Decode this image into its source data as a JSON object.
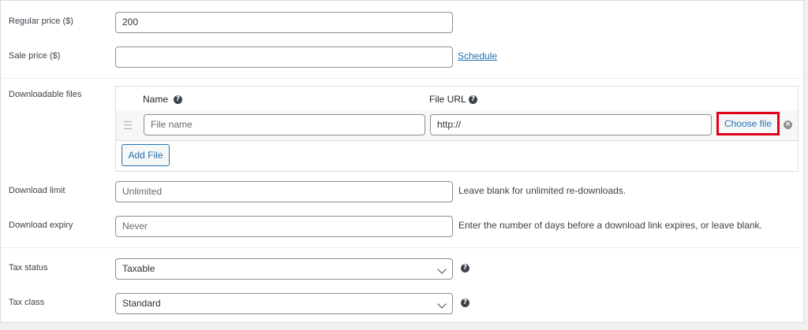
{
  "pricing": {
    "regular_label": "Regular price ($)",
    "regular_value": "200",
    "sale_label": "Sale price ($)",
    "sale_value": "",
    "schedule_link": "Schedule"
  },
  "downloads": {
    "label": "Downloadable files",
    "col_name": "Name",
    "col_url": "File URL",
    "file_name_placeholder": "File name",
    "file_url_value": "http://",
    "choose_file_label": "Choose file",
    "remove_icon": "×",
    "add_file_label": "Add File",
    "help_icon": "?"
  },
  "limits": {
    "limit_label": "Download limit",
    "limit_placeholder": "Unlimited",
    "limit_desc": "Leave blank for unlimited re-downloads.",
    "expiry_label": "Download expiry",
    "expiry_placeholder": "Never",
    "expiry_desc": "Enter the number of days before a download link expires, or leave blank."
  },
  "tax": {
    "status_label": "Tax status",
    "status_value": "Taxable",
    "class_label": "Tax class",
    "class_value": "Standard",
    "help_icon": "?"
  },
  "colors": {
    "link": "#2271b1",
    "highlight_border": "#e2001a"
  }
}
